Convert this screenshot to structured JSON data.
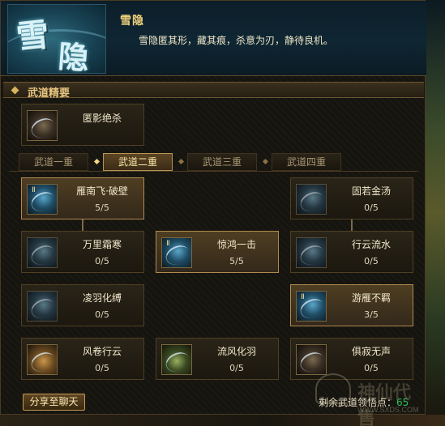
{
  "header": {
    "emblem_chars": [
      "雪",
      "隐"
    ],
    "title": "雪隐",
    "description": "雪隐匿其形，藏其痕，杀意为刃，静待良机。"
  },
  "section": {
    "title": "武道精要",
    "main_skill": {
      "name": "匿影绝杀",
      "icon": "shadow-strike-icon"
    }
  },
  "tabs": [
    {
      "label": "武道一重",
      "active": false
    },
    {
      "label": "武道二重",
      "active": true
    },
    {
      "label": "武道三重",
      "active": false
    },
    {
      "label": "武道四重",
      "active": false
    }
  ],
  "skills": [
    {
      "name": "雁南飞·破壁",
      "level": "5/5",
      "learned": true,
      "icon": "wild-goose-icon"
    },
    {
      "name": "固若金汤",
      "level": "0/5",
      "learned": false,
      "icon": "golden-defense-icon"
    },
    {
      "name": "万里霜寒",
      "level": "0/5",
      "learned": false,
      "icon": "frost-icon"
    },
    {
      "name": "惊鸿一击",
      "level": "5/5",
      "learned": true,
      "icon": "swan-strike-icon"
    },
    {
      "name": "行云流水",
      "level": "0/5",
      "learned": false,
      "icon": "flowing-cloud-icon"
    },
    {
      "name": "凌羽化缚",
      "level": "0/5",
      "learned": false,
      "icon": "feather-bind-icon"
    },
    {
      "name": "游雁不羁",
      "level": "3/5",
      "learned": true,
      "icon": "roaming-goose-icon"
    },
    {
      "name": "风卷行云",
      "level": "0/5",
      "learned": false,
      "icon": "wind-cloud-icon"
    },
    {
      "name": "流风化羽",
      "level": "0/5",
      "learned": false,
      "icon": "wind-feather-icon"
    },
    {
      "name": "俱寂无声",
      "level": "0/5",
      "learned": false,
      "icon": "silence-icon"
    }
  ],
  "footer": {
    "share_label": "分享至聊天",
    "points_label": "剩余武道领悟点：",
    "points_value": "65",
    "watermark_text": "神仙代售",
    "watermark_url": "WWW.SXDS.COM"
  },
  "colors": {
    "accent_gold": "#e7c680",
    "points_green": "#29c25c",
    "learned_border": "#b08a4e"
  }
}
